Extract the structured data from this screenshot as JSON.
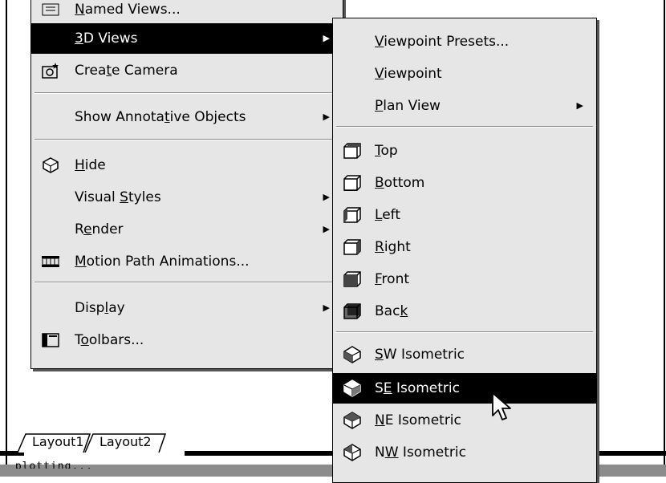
{
  "main_menu": {
    "items": [
      {
        "name": "named-views",
        "pre": "",
        "key": "N",
        "post": "amed Views...",
        "icon": "named-views-icon"
      },
      {
        "name": "3d-views",
        "pre": "",
        "key": "3",
        "post": "D Views",
        "submenu": true,
        "highlighted": true
      },
      {
        "name": "create-camera",
        "pre": "Crea",
        "key": "t",
        "post": "e Camera",
        "icon": "camera-icon"
      },
      {
        "name": "show-annotative",
        "pre": "Show Annota",
        "key": "t",
        "post": "ive Objects",
        "submenu": true
      },
      {
        "name": "hide",
        "pre": "",
        "key": "H",
        "post": "ide",
        "icon": "hide-icon"
      },
      {
        "name": "visual-styles",
        "pre": "Visual ",
        "key": "S",
        "post": "tyles",
        "submenu": true
      },
      {
        "name": "render",
        "pre": "R",
        "key": "e",
        "post": "nder",
        "submenu": true
      },
      {
        "name": "motion-path",
        "pre": "",
        "key": "M",
        "post": "otion Path Animations...",
        "icon": "film-icon"
      },
      {
        "name": "display",
        "pre": "Disp",
        "key": "l",
        "post": "ay",
        "submenu": true
      },
      {
        "name": "toolbars",
        "pre": "T",
        "key": "o",
        "post": "olbars...",
        "icon": "toolbars-icon"
      }
    ]
  },
  "sub_menu": {
    "items": [
      {
        "name": "viewpoint-presets",
        "pre": "",
        "key": "V",
        "post": "iewpoint Presets..."
      },
      {
        "name": "viewpoint",
        "pre": "",
        "key": "V",
        "post": "iewpoint"
      },
      {
        "name": "plan-view",
        "pre": "",
        "key": "P",
        "post": "lan View",
        "submenu": true
      },
      {
        "name": "top",
        "pre": "",
        "key": "T",
        "post": "op",
        "icon": "view-top-icon"
      },
      {
        "name": "bottom",
        "pre": "",
        "key": "B",
        "post": "ottom",
        "icon": "view-bottom-icon"
      },
      {
        "name": "left",
        "pre": "",
        "key": "L",
        "post": "eft",
        "icon": "view-left-icon"
      },
      {
        "name": "right",
        "pre": "",
        "key": "R",
        "post": "ight",
        "icon": "view-right-icon"
      },
      {
        "name": "front",
        "pre": "",
        "key": "F",
        "post": "ront",
        "icon": "view-front-icon"
      },
      {
        "name": "back",
        "pre": "Bac",
        "key": "k",
        "post": "",
        "icon": "view-back-icon"
      },
      {
        "name": "sw-isometric",
        "pre": "",
        "key": "S",
        "post": "W Isometric",
        "icon": "iso-sw-icon"
      },
      {
        "name": "se-isometric",
        "pre": "S",
        "key": "E",
        "post": " Isometric",
        "icon": "iso-se-icon",
        "highlighted": true
      },
      {
        "name": "ne-isometric",
        "pre": "",
        "key": "N",
        "post": "E Isometric",
        "icon": "iso-ne-icon"
      },
      {
        "name": "nw-isometric",
        "pre": "N",
        "key": "W",
        "post": " Isometric",
        "icon": "iso-nw-icon"
      }
    ]
  },
  "layout_tabs": [
    "Layout1",
    "Layout2"
  ],
  "command_line": "_plotting..."
}
